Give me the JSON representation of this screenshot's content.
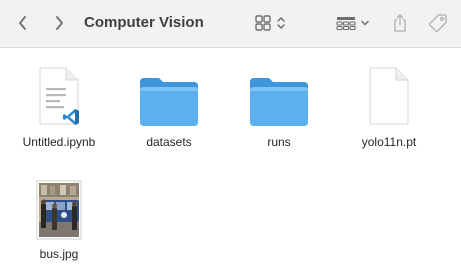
{
  "window": {
    "title": "Computer Vision"
  },
  "toolbar": {
    "back_icon": "chevron-left-icon",
    "forward_icon": "chevron-right-icon",
    "view_icon": "grid-view-icon",
    "group_icon": "group-list-icon",
    "share_icon": "share-icon",
    "tag_icon": "tag-icon"
  },
  "files": [
    {
      "name": "Untitled.ipynb",
      "kind": "notebook",
      "icon": "vscode-document-icon"
    },
    {
      "name": "datasets",
      "kind": "folder",
      "icon": "folder-icon",
      "color": "#5bb0ee"
    },
    {
      "name": "runs",
      "kind": "folder",
      "icon": "folder-icon",
      "color": "#5bb0ee"
    },
    {
      "name": "yolo11n.pt",
      "kind": "document",
      "icon": "blank-document-icon"
    },
    {
      "name": "bus.jpg",
      "kind": "image",
      "icon": "image-thumbnail-icon"
    }
  ],
  "colors": {
    "toolbar_bg": "#f3f2f3",
    "folder_blue": "#5bb0ee",
    "vscode_blue": "#2a8bd4"
  }
}
